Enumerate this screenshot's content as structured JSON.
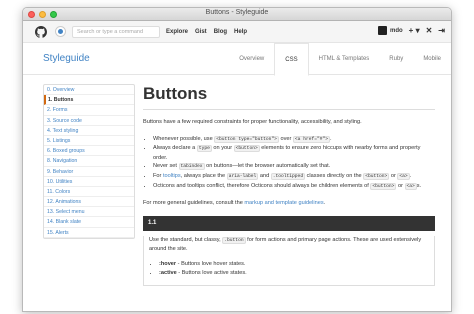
{
  "window": {
    "title": "Buttons - Styleguide"
  },
  "github_header": {
    "search_placeholder": "Search or type a command",
    "nav": [
      "Explore",
      "Gist",
      "Blog",
      "Help"
    ],
    "username": "mdo",
    "plus_icon": "+ ▾",
    "tools_icon": "✕",
    "signout_icon": "⇥"
  },
  "styleguide": {
    "title": "Styleguide",
    "tabs": [
      "Overview",
      "CSS",
      "HTML & Templates",
      "Ruby",
      "Mobile"
    ],
    "active_tab": "CSS"
  },
  "sidebar": {
    "items": [
      "0. Overview",
      "1. Buttons",
      "2. Forms",
      "3. Source code",
      "4. Text styling",
      "5. Listings",
      "6. Boxed groups",
      "8. Navigation",
      "9. Behavior",
      "10. Utilities",
      "11. Colors",
      "12. Animations",
      "13. Select menu",
      "14. Blank slate",
      "15. Alerts"
    ],
    "active_index": 1
  },
  "main": {
    "heading": "Buttons",
    "intro": "Buttons have a few required constraints for proper functionality, accessibility, and styling.",
    "bullets": [
      {
        "parts": [
          {
            "t": "Whenever possible, use "
          },
          {
            "c": "<button type=\"button\">"
          },
          {
            "t": " over "
          },
          {
            "c": "<a href=\"#\">"
          },
          {
            "t": "."
          }
        ]
      },
      {
        "parts": [
          {
            "t": "Always declare a "
          },
          {
            "c": "type"
          },
          {
            "t": " on your "
          },
          {
            "c": "<button>"
          },
          {
            "t": " elements to ensure zero hiccups with nearby forms and property order."
          }
        ]
      },
      {
        "parts": [
          {
            "t": "Never set "
          },
          {
            "c": "tabindex"
          },
          {
            "t": " on buttons—let the browser automatically set that."
          }
        ]
      },
      {
        "parts": [
          {
            "t": "For "
          },
          {
            "l": "tooltips"
          },
          {
            "t": ", always place the "
          },
          {
            "c": "aria-label"
          },
          {
            "t": " and "
          },
          {
            "c": ".tooltipped"
          },
          {
            "t": " classes directly on the "
          },
          {
            "c": "<button>"
          },
          {
            "t": " or "
          },
          {
            "c": "<a>"
          },
          {
            "t": "."
          }
        ]
      },
      {
        "parts": [
          {
            "t": "Octicons and tooltips conflict, therefore Octicons should always be children elements of "
          },
          {
            "c": "<button>"
          },
          {
            "t": " or "
          },
          {
            "c": "<a>"
          },
          {
            "t": "s."
          }
        ]
      }
    ],
    "guidelines_prefix": "For more general guidelines, consult the ",
    "guidelines_link": "markup and template guidelines",
    "guidelines_suffix": ".",
    "section_number": "1.1",
    "section_desc_prefix": "Use the standard, but classy, ",
    "section_desc_code": ".button",
    "section_desc_suffix": " for form actions and primary page actions. These are used extensively around the site.",
    "states": [
      {
        "name": ":hover",
        "desc": " - Buttons love hover states."
      },
      {
        "name": ":active",
        "desc": " - Buttons love active states."
      }
    ]
  }
}
